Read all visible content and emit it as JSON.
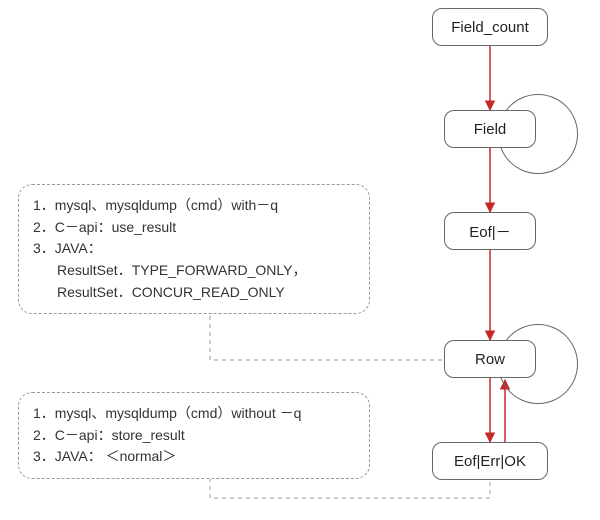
{
  "nodes": {
    "field_count": "Field_count",
    "field": "Field",
    "eof1": "Eof|－",
    "row": "Row",
    "eof2": "Eof|Err|OK"
  },
  "annotations": {
    "upper": {
      "line1": "1．mysql、mysqldump（cmd）with－q",
      "line2": "2．C－api：use_result",
      "line3": "3．JAVA：",
      "line4": "ResultSet．TYPE_FORWARD_ONLY，",
      "line5": "ResultSet．CONCUR_READ_ONLY"
    },
    "lower": {
      "line1": "1．mysql、mysqldump（cmd）without －q",
      "line2": "2．C－api：store_result",
      "line3": "3．JAVA： ＜normal＞"
    }
  },
  "diagram": {
    "type": "flow",
    "flow": [
      "Field_count",
      "Field",
      "Eof|－",
      "Row",
      "Eof|Err|OK"
    ],
    "loops": [
      "Field",
      "Row"
    ],
    "back_edge": {
      "from": "Eof|Err|OK",
      "to": "Row"
    },
    "annot_targets": {
      "upper": "Row",
      "lower": "Eof|Err|OK"
    }
  }
}
